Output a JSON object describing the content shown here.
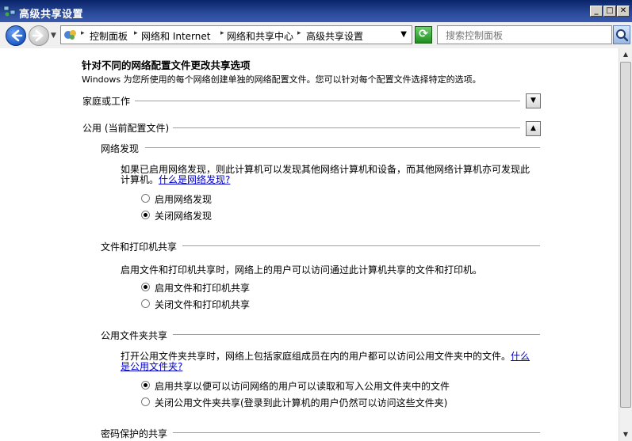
{
  "window": {
    "title": "高级共享设置",
    "min_label": "_",
    "max_label": "□",
    "close_label": "✕"
  },
  "nav": {
    "breadcrumbs": [
      "控制面板",
      "网络和 Internet",
      "网络和共享中心",
      "高级共享设置"
    ],
    "search_placeholder": "搜索控制面板"
  },
  "page": {
    "heading": "针对不同的网络配置文件更改共享选项",
    "subtitle": "Windows 为您所使用的每个网络创建单独的网络配置文件。您可以针对每个配置文件选择特定的选项。",
    "profiles": [
      {
        "label": "家庭或工作",
        "expanded": false
      },
      {
        "label": "公用 (当前配置文件)",
        "expanded": true
      }
    ],
    "sections": {
      "discovery": {
        "title": "网络发现",
        "desc": "如果已启用网络发现，则此计算机可以发现其他网络计算机和设备，而其他网络计算机亦可发现此计算机。",
        "link": "什么是网络发现?",
        "options": [
          "启用网络发现",
          "关闭网络发现"
        ],
        "selected": 1
      },
      "printer": {
        "title": "文件和打印机共享",
        "desc": "启用文件和打印机共享时，网络上的用户可以访问通过此计算机共享的文件和打印机。",
        "options": [
          "启用文件和打印机共享",
          "关闭文件和打印机共享"
        ],
        "selected": 0
      },
      "public_folder": {
        "title": "公用文件夹共享",
        "desc": "打开公用文件夹共享时，网络上包括家庭组成员在内的用户都可以访问公用文件夹中的文件。",
        "link": "什么是公用文件夹?",
        "options": [
          "启用共享以便可以访问网络的用户可以读取和写入公用文件夹中的文件",
          "关闭公用文件夹共享(登录到此计算机的用户仍然可以访问这些文件夹)"
        ],
        "selected": 0
      },
      "password": {
        "title": "密码保护的共享"
      }
    }
  },
  "colors": {
    "titlebar": "#0a246a",
    "link": "#0000cc"
  },
  "icons": [
    "network-icon",
    "control-panel-icon",
    "search-icon",
    "refresh-icon",
    "back-arrow-icon",
    "forward-arrow-icon"
  ]
}
